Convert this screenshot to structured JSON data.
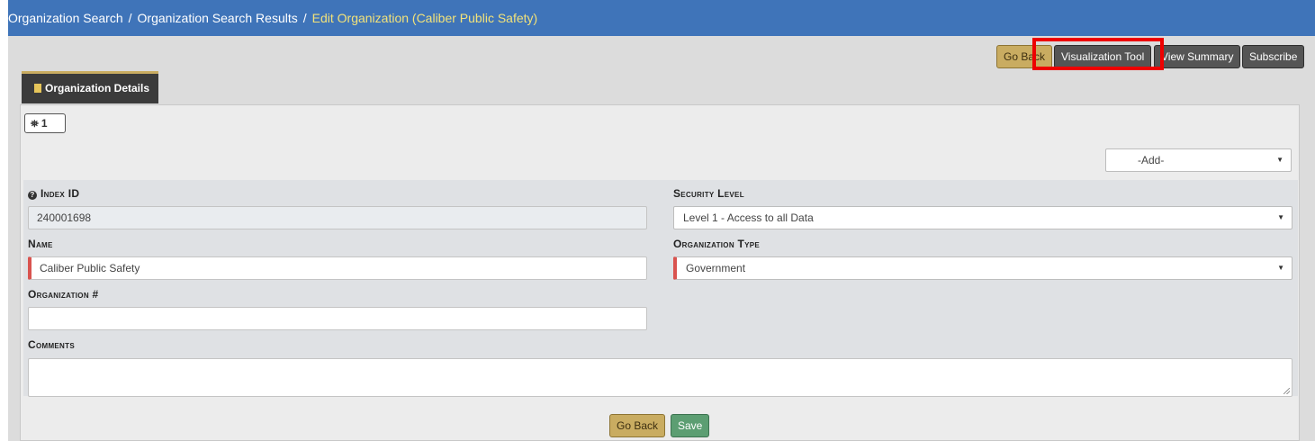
{
  "breadcrumb": {
    "items": [
      "Organization Search",
      "Organization Search Results"
    ],
    "current": "Edit Organization (Caliber Public Safety)",
    "separator": "/"
  },
  "toolbar": {
    "go_back": "Go Back",
    "visualization_tool": "Visualization Tool",
    "view_summary": "View Summary",
    "subscribe": "Subscribe"
  },
  "tab": {
    "label": "Organization Details",
    "icon": "building-icon"
  },
  "map_button": {
    "icon": "map-marker-icon",
    "count": "1"
  },
  "add_select": {
    "value": "-Add-"
  },
  "fields": {
    "index_id": {
      "label": "Index ID",
      "value": "240001698"
    },
    "security_level": {
      "label": "Security Level",
      "value": "Level 1 - Access to all Data"
    },
    "name": {
      "label": "Name",
      "value": "Caliber Public Safety"
    },
    "organization_type": {
      "label": "Organization Type",
      "value": "Government"
    },
    "organization_number": {
      "label": "Organization #",
      "value": ""
    },
    "comments": {
      "label": "Comments",
      "value": ""
    }
  },
  "footer": {
    "go_back": "Go Back",
    "save": "Save"
  },
  "colors": {
    "header": "#3f74b9",
    "current_crumb": "#f2e27a",
    "gold_button": "#c9ac61",
    "dark_button": "#555555",
    "save_button": "#5c9e72",
    "required_marker": "#d9534f",
    "highlight": "#ee0000"
  }
}
